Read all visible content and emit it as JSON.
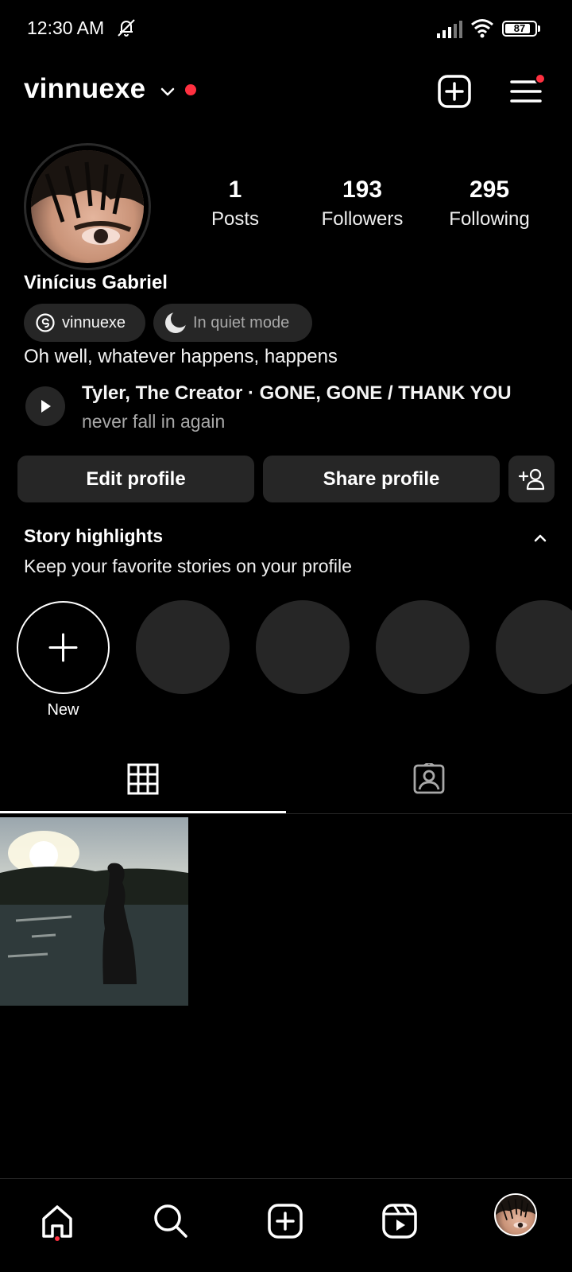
{
  "status_bar": {
    "time": "12:30 AM",
    "battery_level": "87",
    "battery_fraction": 0.87
  },
  "header": {
    "username": "vinnuexe"
  },
  "profile": {
    "display_name": "Vinícius Gabriel",
    "stats": [
      {
        "value": "1",
        "label": "Posts"
      },
      {
        "value": "193",
        "label": "Followers"
      },
      {
        "value": "295",
        "label": "Following"
      }
    ],
    "threads_handle": "vinnuexe",
    "quiet_mode_label": "In quiet mode",
    "bio": "Oh well, whatever happens, happens",
    "music": {
      "title": "Tyler, The Creator · GONE, GONE / THANK YOU",
      "subtitle": "never fall in again"
    }
  },
  "actions": {
    "edit_label": "Edit profile",
    "share_label": "Share profile"
  },
  "highlights": {
    "title": "Story highlights",
    "subtitle": "Keep your favorite stories on your profile",
    "new_label": "New"
  },
  "icons": {
    "header": [
      "chevron-down-icon",
      "create-post-icon",
      "menu-icon"
    ],
    "tabs": [
      "grid-icon",
      "tagged-icon"
    ],
    "nav": [
      "home-icon",
      "search-icon",
      "create-icon",
      "reels-icon",
      "profile-avatar"
    ]
  },
  "colors": {
    "background": "#000000",
    "surface": "#262626",
    "notification": "#ff3040",
    "muted_text": "#a8a8a8"
  }
}
